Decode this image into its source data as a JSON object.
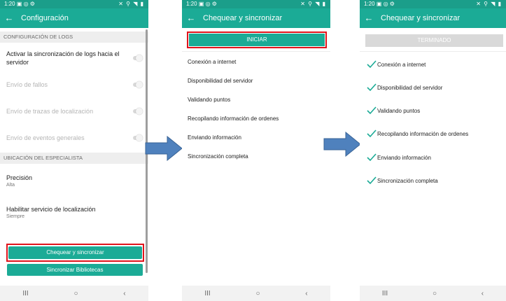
{
  "status": {
    "time": "1:20",
    "left_icons": "▣ ◎ ⚙",
    "right_icons": "✕ ⚲ ◥ ▮"
  },
  "nav": {
    "recents": "III",
    "home": "○",
    "back": "‹"
  },
  "screen1": {
    "title": "Configuración",
    "back_icon": "←",
    "section_logs": "CONFIGURACIÓN DE LOGS",
    "settings": [
      {
        "label": "Activar la sincronización de logs hacia el servidor",
        "enabled": true
      },
      {
        "label": "Envío de fallos",
        "enabled": false
      },
      {
        "label": "Envío de trazas de localización",
        "enabled": false
      },
      {
        "label": "Envío de eventos generales",
        "enabled": false
      }
    ],
    "section_location": "UBICACIÓN DEL ESPECIALISTA",
    "precision": {
      "label": "Precisión",
      "value": "Alta"
    },
    "location_service": {
      "label": "Habilitar servicio de localización",
      "value": "Siempre"
    },
    "check_sync_button": "Chequear y sincronizar",
    "sync_libraries_button": "Sincronizar Bibliotecas"
  },
  "screen2": {
    "title": "Chequear y sincronizar",
    "back_icon": "←",
    "start_button": "INICIAR",
    "steps": [
      "Conexión a internet",
      "Disponibilidad del servidor",
      "Validando puntos",
      "Recopilando información de ordenes",
      "Enviando información",
      "Sincronización completa"
    ]
  },
  "screen3": {
    "title": "Chequear y sincronizar",
    "back_icon": "←",
    "done_button": "TERMINADO",
    "steps": [
      "Conexión a internet",
      "Disponibilidad del servidor",
      "Validando puntos",
      "Recopilando información de ordenes",
      "Enviando información",
      "Sincronización completa"
    ]
  },
  "colors": {
    "teal": "#1bab96",
    "teal_dark": "#1b9e8a",
    "highlight": "#e0141c",
    "arrow": "#4f81bd"
  }
}
